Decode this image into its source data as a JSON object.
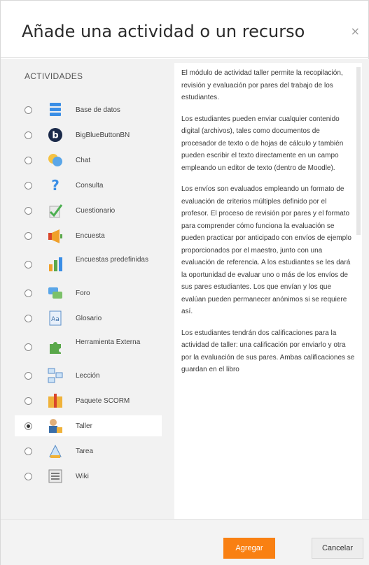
{
  "dialog": {
    "title": "Añade una actividad o un recurso",
    "close_glyph": "×"
  },
  "list": {
    "heading": "ACTIVIDADES",
    "items": [
      {
        "label": "Base de datos",
        "icon": "database-icon",
        "selected": false
      },
      {
        "label": "BigBlueButtonBN",
        "icon": "bigbluebutton-icon",
        "selected": false
      },
      {
        "label": "Chat",
        "icon": "chat-icon",
        "selected": false
      },
      {
        "label": "Consulta",
        "icon": "question-icon",
        "selected": false
      },
      {
        "label": "Cuestionario",
        "icon": "checkmark-quiz-icon",
        "selected": false
      },
      {
        "label": "Encuesta",
        "icon": "megaphone-icon",
        "selected": false
      },
      {
        "label": "Encuestas predefinidas",
        "icon": "bar-chart-icon",
        "selected": false
      },
      {
        "label": "Foro",
        "icon": "forum-icon",
        "selected": false
      },
      {
        "label": "Glosario",
        "icon": "glossary-icon",
        "selected": false
      },
      {
        "label": "Herramienta Externa",
        "icon": "puzzle-icon",
        "selected": false
      },
      {
        "label": "Lección",
        "icon": "lesson-icon",
        "selected": false
      },
      {
        "label": "Paquete SCORM",
        "icon": "package-icon",
        "selected": false
      },
      {
        "label": "Taller",
        "icon": "workshop-icon",
        "selected": true
      },
      {
        "label": "Tarea",
        "icon": "assignment-icon",
        "selected": false
      },
      {
        "label": "Wiki",
        "icon": "wiki-icon",
        "selected": false
      }
    ]
  },
  "description": {
    "paragraphs": [
      "El módulo de actividad taller permite la recopilación, revisión y evaluación por pares del trabajo de los estudiantes.",
      "Los estudiantes pueden enviar cualquier contenido digital (archivos), tales como documentos de procesador de texto o de hojas de cálculo y también pueden escribir el texto directamente en un campo empleando un editor de texto (dentro de Moodle).",
      "Los envíos son evaluados empleando un formato de evaluación de criterios múltiples definido por el profesor. El proceso de revisión por pares y el formato para comprender cómo funciona la evaluación se pueden practicar por anticipado con envíos de ejemplo proporcionados por el maestro, junto con una evaluación de referencia. A los estudiantes se les dará la oportunidad de evaluar uno o más de los envíos de sus pares estudiantes. Los que envían y los que evalúan pueden permanecer anónimos si se requiere así.",
      "Los estudiantes tendrán dos calificaciones para la actividad de taller: una calificación por enviarlo y otra por la evaluación de sus pares. Ambas calificaciones se guardan en el libro"
    ]
  },
  "footer": {
    "add_label": "Agregar",
    "cancel_label": "Cancelar"
  },
  "colors": {
    "accent": "#f98012",
    "arrow": "#cc1f1f"
  }
}
